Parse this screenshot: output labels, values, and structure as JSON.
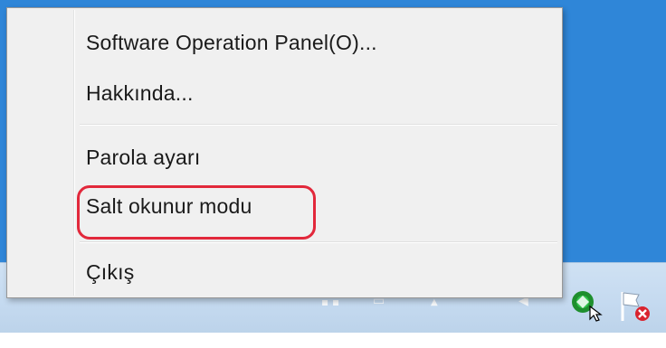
{
  "context_menu": {
    "items": [
      {
        "label": "Software Operation Panel(O)..."
      },
      {
        "label": "Hakkında..."
      },
      {
        "label": "Parola ayarı"
      },
      {
        "label": "Salt okunur modu"
      },
      {
        "label": "Çıkış"
      }
    ],
    "highlighted_item": "Salt okunur modu",
    "highlight_color": "#e2283b"
  },
  "tray": {
    "icons": [
      "network-icon",
      "volume-icon",
      "show-hidden-icons-arrow",
      "scanner-app-icon",
      "action-center-flag-icon"
    ]
  },
  "colors": {
    "desktop": "#2f86d8",
    "taskbar": "#c5daf0",
    "menu_background": "#f0f0f0"
  }
}
